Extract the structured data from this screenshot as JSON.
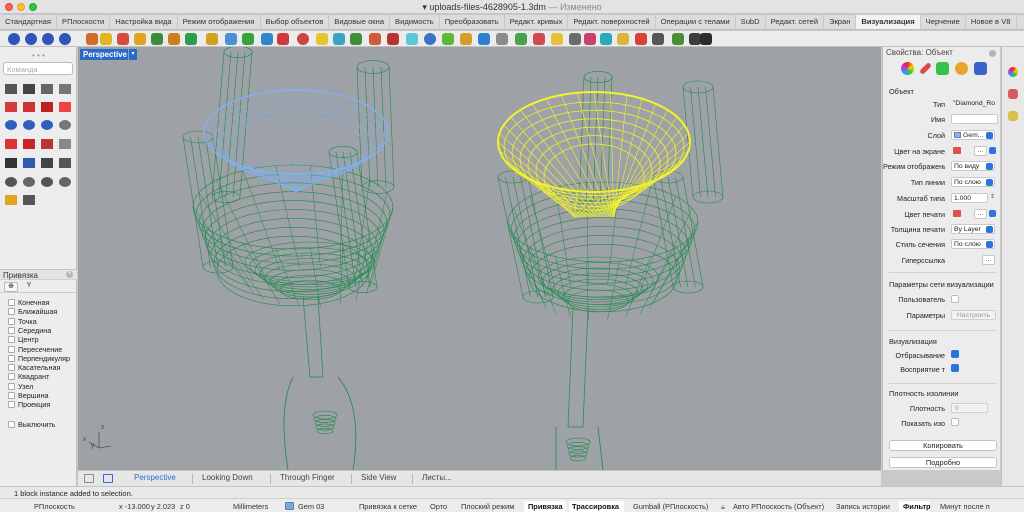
{
  "window": {
    "title": "uploads-files-4628905-1.3dm",
    "title_suffix": "— Изменено"
  },
  "tabs": [
    "Стандартная",
    "РПлоскости",
    "Настройка вида",
    "Режим отображения",
    "Выбор объектов",
    "Видовые окна",
    "Видимость",
    "Преобразовать",
    "Редакт. кривых",
    "Редакт. поверхностей",
    "Операции с телами",
    "SubD",
    "Редакт. сетей",
    "Экран",
    "Визуализация",
    "Черчение",
    "Новое в V8"
  ],
  "active_tab": "Визуализация",
  "command": {
    "placeholder": "Команда"
  },
  "snap_panel": {
    "title": "Привязка",
    "items": [
      {
        "label": "Конечная",
        "checked": false
      },
      {
        "label": "Ближайшая",
        "checked": false
      },
      {
        "label": "Точка",
        "checked": false
      },
      {
        "label": "Середина",
        "checked": false
      },
      {
        "label": "Центр",
        "checked": false
      },
      {
        "label": "Пересечение",
        "checked": false
      },
      {
        "label": "Перпендикуляр",
        "checked": false
      },
      {
        "label": "Касательная",
        "checked": false
      },
      {
        "label": "Квадрант",
        "checked": false
      },
      {
        "label": "Узел",
        "checked": false
      },
      {
        "label": "Вершина",
        "checked": false
      },
      {
        "label": "Проекция",
        "checked": false
      }
    ],
    "disable_label": "Выключить"
  },
  "viewport": {
    "label": "Perspective",
    "axis_x": "x",
    "axis_y": "y",
    "axis_z": "z"
  },
  "viewport_tabs": [
    "Perspective",
    "Looking Down",
    "Through Finger",
    "Side View",
    "Листы..."
  ],
  "active_viewport_tab": "Perspective",
  "properties": {
    "title": "Свойства: Объект",
    "section_object": "Объект",
    "rows": {
      "type": {
        "label": "Тип",
        "value": "\"Diamond_Ro"
      },
      "name": {
        "label": "Имя",
        "value": ""
      },
      "layer": {
        "label": "Слой",
        "value": "Gem..."
      },
      "display_color": {
        "label": "Цвет на экране",
        "value": "..."
      },
      "display_mode": {
        "label": "Режим отображения",
        "value": "По виду"
      },
      "linetype": {
        "label": "Тип линии",
        "value": "По слою"
      },
      "linetype_scale": {
        "label": "Масштаб типа",
        "value": "1.000"
      },
      "print_color": {
        "label": "Цвет печати",
        "value": "..."
      },
      "print_width": {
        "label": "Толщина печати",
        "value": "By Layer"
      },
      "section_style": {
        "label": "Стиль сечения",
        "value": "По слою"
      },
      "hyperlink": {
        "label": "Гиперссылка",
        "value": "..."
      }
    },
    "section_mesh": "Параметры сети визуализации",
    "mesh_user": "Пользователь",
    "mesh_params": "Параметры",
    "mesh_configure": "Настроить",
    "section_render": "Визуализация",
    "cast_shadows": {
      "label": "Отбрасывание",
      "checked": true
    },
    "receive_shadows": {
      "label": "Восприятие т",
      "checked": true
    },
    "section_isocurve": "Плотность изолинии",
    "isocurve_density": {
      "label": "Плотность",
      "value": "0"
    },
    "show_isocurves": {
      "label": "Показать изо",
      "checked": false
    },
    "copy_button": "Копировать",
    "details_button": "Подробно"
  },
  "status_message": "1 block instance added to selection.",
  "statusbar": {
    "cplane": "РПлоскость",
    "x": "x -13.000",
    "y": "y 2.023",
    "z": "z 0",
    "units": "Millimeters",
    "layer": "Gem 03",
    "grid_snap": "Привязка к сетке",
    "ortho": "Орто",
    "planar": "Плоский режим",
    "osnap": "Привязка",
    "smarttrack": "Трассировка",
    "gumball": "Gumball (РПлоскость)",
    "auto_cplane": "Авто РПлоскость (Объект)",
    "history": "Запись истории",
    "filter": "Фильтр",
    "minutes": "Минут после п"
  },
  "colors": {
    "wire_green": "#1f8a4c",
    "selected_yellow": "#f4f32a",
    "selected_blue": "#7fb0f2",
    "viewport_bg": "#9ea1a6",
    "accent": "#2b74e0"
  }
}
